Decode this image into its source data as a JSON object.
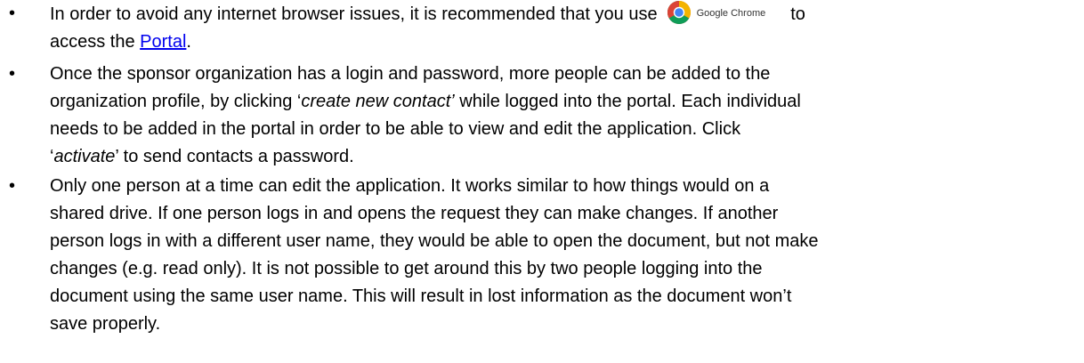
{
  "bullet_glyph": "•",
  "items": [
    {
      "line1_prefix": "In order to avoid any internet browser issues, it is recommended that you use",
      "browser_icon": "google-chrome-icon",
      "browser_name": "Google Chrome",
      "line1_suffix": "to",
      "line2_prefix": "access the ",
      "link_text": "Portal",
      "line2_suffix": "."
    },
    {
      "line1": "Once the sponsor organization has a login and password, more people can be added to the",
      "line2_prefix": "organization profile, by clicking ‘",
      "line2_em": "create new contact’",
      "line2_suffix": " while logged into the portal.  Each individual",
      "line3": "needs to be added in the portal in order to be able to view and edit the application.  Click",
      "line4_prefix": "‘",
      "line4_em": "activate",
      "line4_suffix": "’ to send contacts a password."
    },
    {
      "lines": [
        "Only one person at a time can edit the application.  It works similar to how things would on a",
        "shared drive.  If one person logs in and opens the request they can make changes. If another",
        "person logs in with a different user name, they would be able to open the document, but not make",
        "changes (e.g. read only).  It is not possible to get around this by two people logging into the",
        "document using the same user name.  This will result in lost information as the document won’t",
        "save properly."
      ]
    }
  ]
}
